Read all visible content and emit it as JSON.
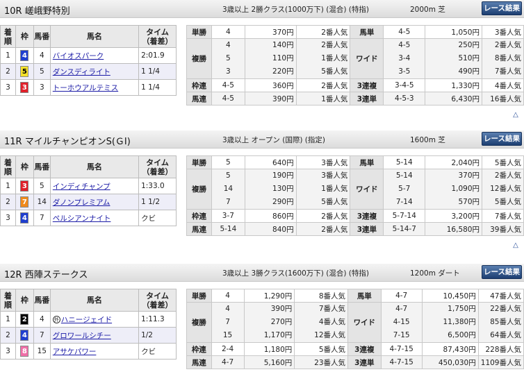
{
  "button_label": "レース結果",
  "up_arrow": "△",
  "colors": {
    "w1": "#ffffff",
    "w2": "#000000",
    "w3": "#e0202a",
    "w4": "#1f3fcf",
    "w5": "#f5e12a",
    "w6": "#3aa34a",
    "w7": "#f08a1c",
    "w8": "#f06fa8"
  },
  "col_headers": {
    "rank": "着順",
    "waku": "枠",
    "umaban": "馬番",
    "horse": "馬名",
    "time": "タイム（着差）"
  },
  "races": [
    {
      "title": "10R 嵯峨野特別",
      "cond": "3歳以上 2勝クラス(1000万下) (混合) (特指)",
      "dist": "2000m 芝",
      "results": [
        {
          "rank": "1",
          "waku": "4",
          "num": "4",
          "name": "バイオスパーク",
          "time": "2:01.9"
        },
        {
          "rank": "2",
          "waku": "5",
          "num": "5",
          "name": "ダンスディライト",
          "time": "1 1/4"
        },
        {
          "rank": "3",
          "waku": "3",
          "num": "3",
          "name": "トーホウアルテミス",
          "time": "1 1/4"
        }
      ],
      "tansho": {
        "label": "単勝",
        "combo": "4",
        "pay": "370円",
        "pop": "2番人気"
      },
      "umatan": {
        "label": "馬単",
        "combo": "4-5",
        "pay": "1,050円",
        "pop": "3番人気"
      },
      "fukusho": {
        "label": "複勝",
        "rows": [
          {
            "combo": "4",
            "pay": "140円",
            "pop": "2番人気"
          },
          {
            "combo": "5",
            "pay": "110円",
            "pop": "1番人気"
          },
          {
            "combo": "3",
            "pay": "220円",
            "pop": "5番人気"
          }
        ]
      },
      "wide": {
        "label": "ワイド",
        "rows": [
          {
            "combo": "4-5",
            "pay": "250円",
            "pop": "2番人気"
          },
          {
            "combo": "3-4",
            "pay": "510円",
            "pop": "8番人気"
          },
          {
            "combo": "3-5",
            "pay": "490円",
            "pop": "7番人気"
          }
        ]
      },
      "wakuren": {
        "label": "枠連",
        "combo": "4-5",
        "pay": "360円",
        "pop": "2番人気"
      },
      "sanrenpuku": {
        "label": "3連複",
        "combo": "3-4-5",
        "pay": "1,330円",
        "pop": "4番人気"
      },
      "umaren": {
        "label": "馬連",
        "combo": "4-5",
        "pay": "390円",
        "pop": "1番人気"
      },
      "sanrentan": {
        "label": "3連単",
        "combo": "4-5-3",
        "pay": "6,430円",
        "pop": "16番人気"
      }
    },
    {
      "title": "11R マイルチャンピオンS(ＧⅠ)",
      "cond": "3歳以上 オープン (国際) (指定)",
      "dist": "1600m 芝",
      "results": [
        {
          "rank": "1",
          "waku": "3",
          "num": "5",
          "name": "インディチャンプ",
          "time": "1:33.0"
        },
        {
          "rank": "2",
          "waku": "7",
          "num": "14",
          "name": "ダノンプレミアム",
          "time": "1 1/2"
        },
        {
          "rank": "3",
          "waku": "4",
          "num": "7",
          "name": "ペルシアンナイト",
          "time": "クビ"
        }
      ],
      "tansho": {
        "label": "単勝",
        "combo": "5",
        "pay": "640円",
        "pop": "3番人気"
      },
      "umatan": {
        "label": "馬単",
        "combo": "5-14",
        "pay": "2,040円",
        "pop": "5番人気"
      },
      "fukusho": {
        "label": "複勝",
        "rows": [
          {
            "combo": "5",
            "pay": "190円",
            "pop": "3番人気"
          },
          {
            "combo": "14",
            "pay": "130円",
            "pop": "1番人気"
          },
          {
            "combo": "7",
            "pay": "290円",
            "pop": "5番人気"
          }
        ]
      },
      "wide": {
        "label": "ワイド",
        "rows": [
          {
            "combo": "5-14",
            "pay": "370円",
            "pop": "2番人気"
          },
          {
            "combo": "5-7",
            "pay": "1,090円",
            "pop": "12番人気"
          },
          {
            "combo": "7-14",
            "pay": "570円",
            "pop": "5番人気"
          }
        ]
      },
      "wakuren": {
        "label": "枠連",
        "combo": "3-7",
        "pay": "860円",
        "pop": "2番人気"
      },
      "sanrenpuku": {
        "label": "3連複",
        "combo": "5-7-14",
        "pay": "3,200円",
        "pop": "7番人気"
      },
      "umaren": {
        "label": "馬連",
        "combo": "5-14",
        "pay": "840円",
        "pop": "2番人気"
      },
      "sanrentan": {
        "label": "3連単",
        "combo": "5-14-7",
        "pay": "16,580円",
        "pop": "39番人気"
      }
    },
    {
      "title": "12R 西陣ステークス",
      "cond": "3歳以上 3勝クラス(1600万下) (混合) (特指)",
      "dist": "1200m ダート",
      "results": [
        {
          "rank": "1",
          "waku": "2",
          "num": "4",
          "name": "ハニージェイド",
          "time": "1:11.3",
          "mark": "外"
        },
        {
          "rank": "2",
          "waku": "4",
          "num": "7",
          "name": "グロワールシチー",
          "time": "1/2"
        },
        {
          "rank": "3",
          "waku": "8",
          "num": "15",
          "name": "アサケパワー",
          "time": "クビ"
        }
      ],
      "tansho": {
        "label": "単勝",
        "combo": "4",
        "pay": "1,290円",
        "pop": "8番人気"
      },
      "umatan": {
        "label": "馬単",
        "combo": "4-7",
        "pay": "10,450円",
        "pop": "47番人気"
      },
      "fukusho": {
        "label": "複勝",
        "rows": [
          {
            "combo": "4",
            "pay": "390円",
            "pop": "7番人気"
          },
          {
            "combo": "7",
            "pay": "270円",
            "pop": "4番人気"
          },
          {
            "combo": "15",
            "pay": "1,170円",
            "pop": "12番人気"
          }
        ]
      },
      "wide": {
        "label": "ワイド",
        "rows": [
          {
            "combo": "4-7",
            "pay": "1,750円",
            "pop": "22番人気"
          },
          {
            "combo": "4-15",
            "pay": "11,380円",
            "pop": "85番人気"
          },
          {
            "combo": "7-15",
            "pay": "6,500円",
            "pop": "64番人気"
          }
        ]
      },
      "wakuren": {
        "label": "枠連",
        "combo": "2-4",
        "pay": "1,180円",
        "pop": "5番人気"
      },
      "sanrenpuku": {
        "label": "3連複",
        "combo": "4-7-15",
        "pay": "87,430円",
        "pop": "228番人気"
      },
      "umaren": {
        "label": "馬連",
        "combo": "4-7",
        "pay": "5,160円",
        "pop": "23番人気"
      },
      "sanrentan": {
        "label": "3連単",
        "combo": "4-7-15",
        "pay": "450,030円",
        "pop": "1109番人気"
      }
    }
  ]
}
